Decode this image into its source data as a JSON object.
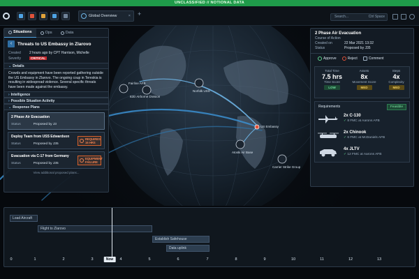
{
  "banner": "UNCLASSIFIED // NOTIONAL DATA",
  "toolbar": {
    "tab_label": "Global Overview",
    "tab_close": "×",
    "tab_add": "+",
    "search_placeholder": "Search...",
    "search_shortcut": "Ctrl Space"
  },
  "left_panel": {
    "tabs": [
      "Situations",
      "Ops",
      "Data"
    ],
    "title": "Threats to US Embassy in Zlarovo",
    "created_label": "Created",
    "created_value": "2 hours ago by CPT Harrison, Michelle",
    "severity_label": "Severity",
    "severity_value": "CRITICAL",
    "details_header": "Details",
    "details_text": "Crowds and equipment have been reported gathering outside the US Embassy in Zlarovo. The ongoing coup in Tereskia is resulting in widespread violence. Several specific threats have been made against the embassy.",
    "intel_header": "Intelligence",
    "activity_header": "Possible Situation Activity",
    "plans_header": "Response Plans",
    "plans": [
      {
        "name": "2 Phase Air Evacuation",
        "status_label": "Status",
        "status_value": "Proposed by J3",
        "warning": ""
      },
      {
        "name": "Deploy Team from USS Edwardson",
        "status_label": "Status",
        "status_value": "Proposed by J35",
        "warning": "REQUIRES 16 HRS"
      },
      {
        "name": "Evacuation via C-17 from Germany",
        "status_label": "Status",
        "status_value": "Proposed by J35",
        "warning": "EQUIPMENT FAILURE"
      }
    ],
    "more_link": "View additional proposed plans..."
  },
  "map_labels": {
    "afb1": "Fairline AFB",
    "div82": "82D Airborne Division",
    "norfolk": "Norfolk USS",
    "embassy": "US Embassy",
    "atoski": "Atoski Air Base",
    "carrier": "Carrier Strike Group"
  },
  "right_panel": {
    "title": "2 Phase Air Evacuation",
    "subtitle": "Course of Action",
    "created_label": "Created on",
    "created_value": "22 Mar 2021 13:32",
    "status_label": "Status",
    "status_value": "Proposed by J35",
    "approve": "Approve",
    "reject": "Reject",
    "comment": "Comment",
    "stats": [
      {
        "label": "Total Time",
        "value": "7.5 hrs",
        "sub_label": "Time Score",
        "badge": "LOW"
      },
      {
        "label": "Assets",
        "value": "8x",
        "sub_label": "Movement Score",
        "badge": "MED"
      },
      {
        "label": "Steps",
        "value": "4x",
        "sub_label": "Complexity",
        "badge": "MED"
      }
    ],
    "req_header": "Requirements",
    "feasible": "Feasible",
    "requirements": [
      {
        "name": "2x C-130",
        "status": "8 FMC at Aarons AFB"
      },
      {
        "name": "2x Chinook",
        "status": "6 FMC at McDaniels AFB"
      },
      {
        "name": "4x JLTV",
        "status": "12 FMC at Aarons AFB"
      }
    ]
  },
  "timeline": {
    "bars": [
      "Load Aircraft",
      "Flight to Zlarovo",
      "Establish Safehouse",
      "Data uplink"
    ],
    "now_label": "Now",
    "ticks": [
      "0",
      "1",
      "2",
      "3",
      "4",
      "5",
      "6",
      "7",
      "8",
      "9",
      "10",
      "11",
      "12",
      "13"
    ]
  },
  "colors": {
    "banner": "#1f9b4a",
    "critical": "#c2292e",
    "accent": "#4ea3e3",
    "warning": "#f08250",
    "low": "#6fe0a0",
    "med": "#f1cf5f"
  }
}
